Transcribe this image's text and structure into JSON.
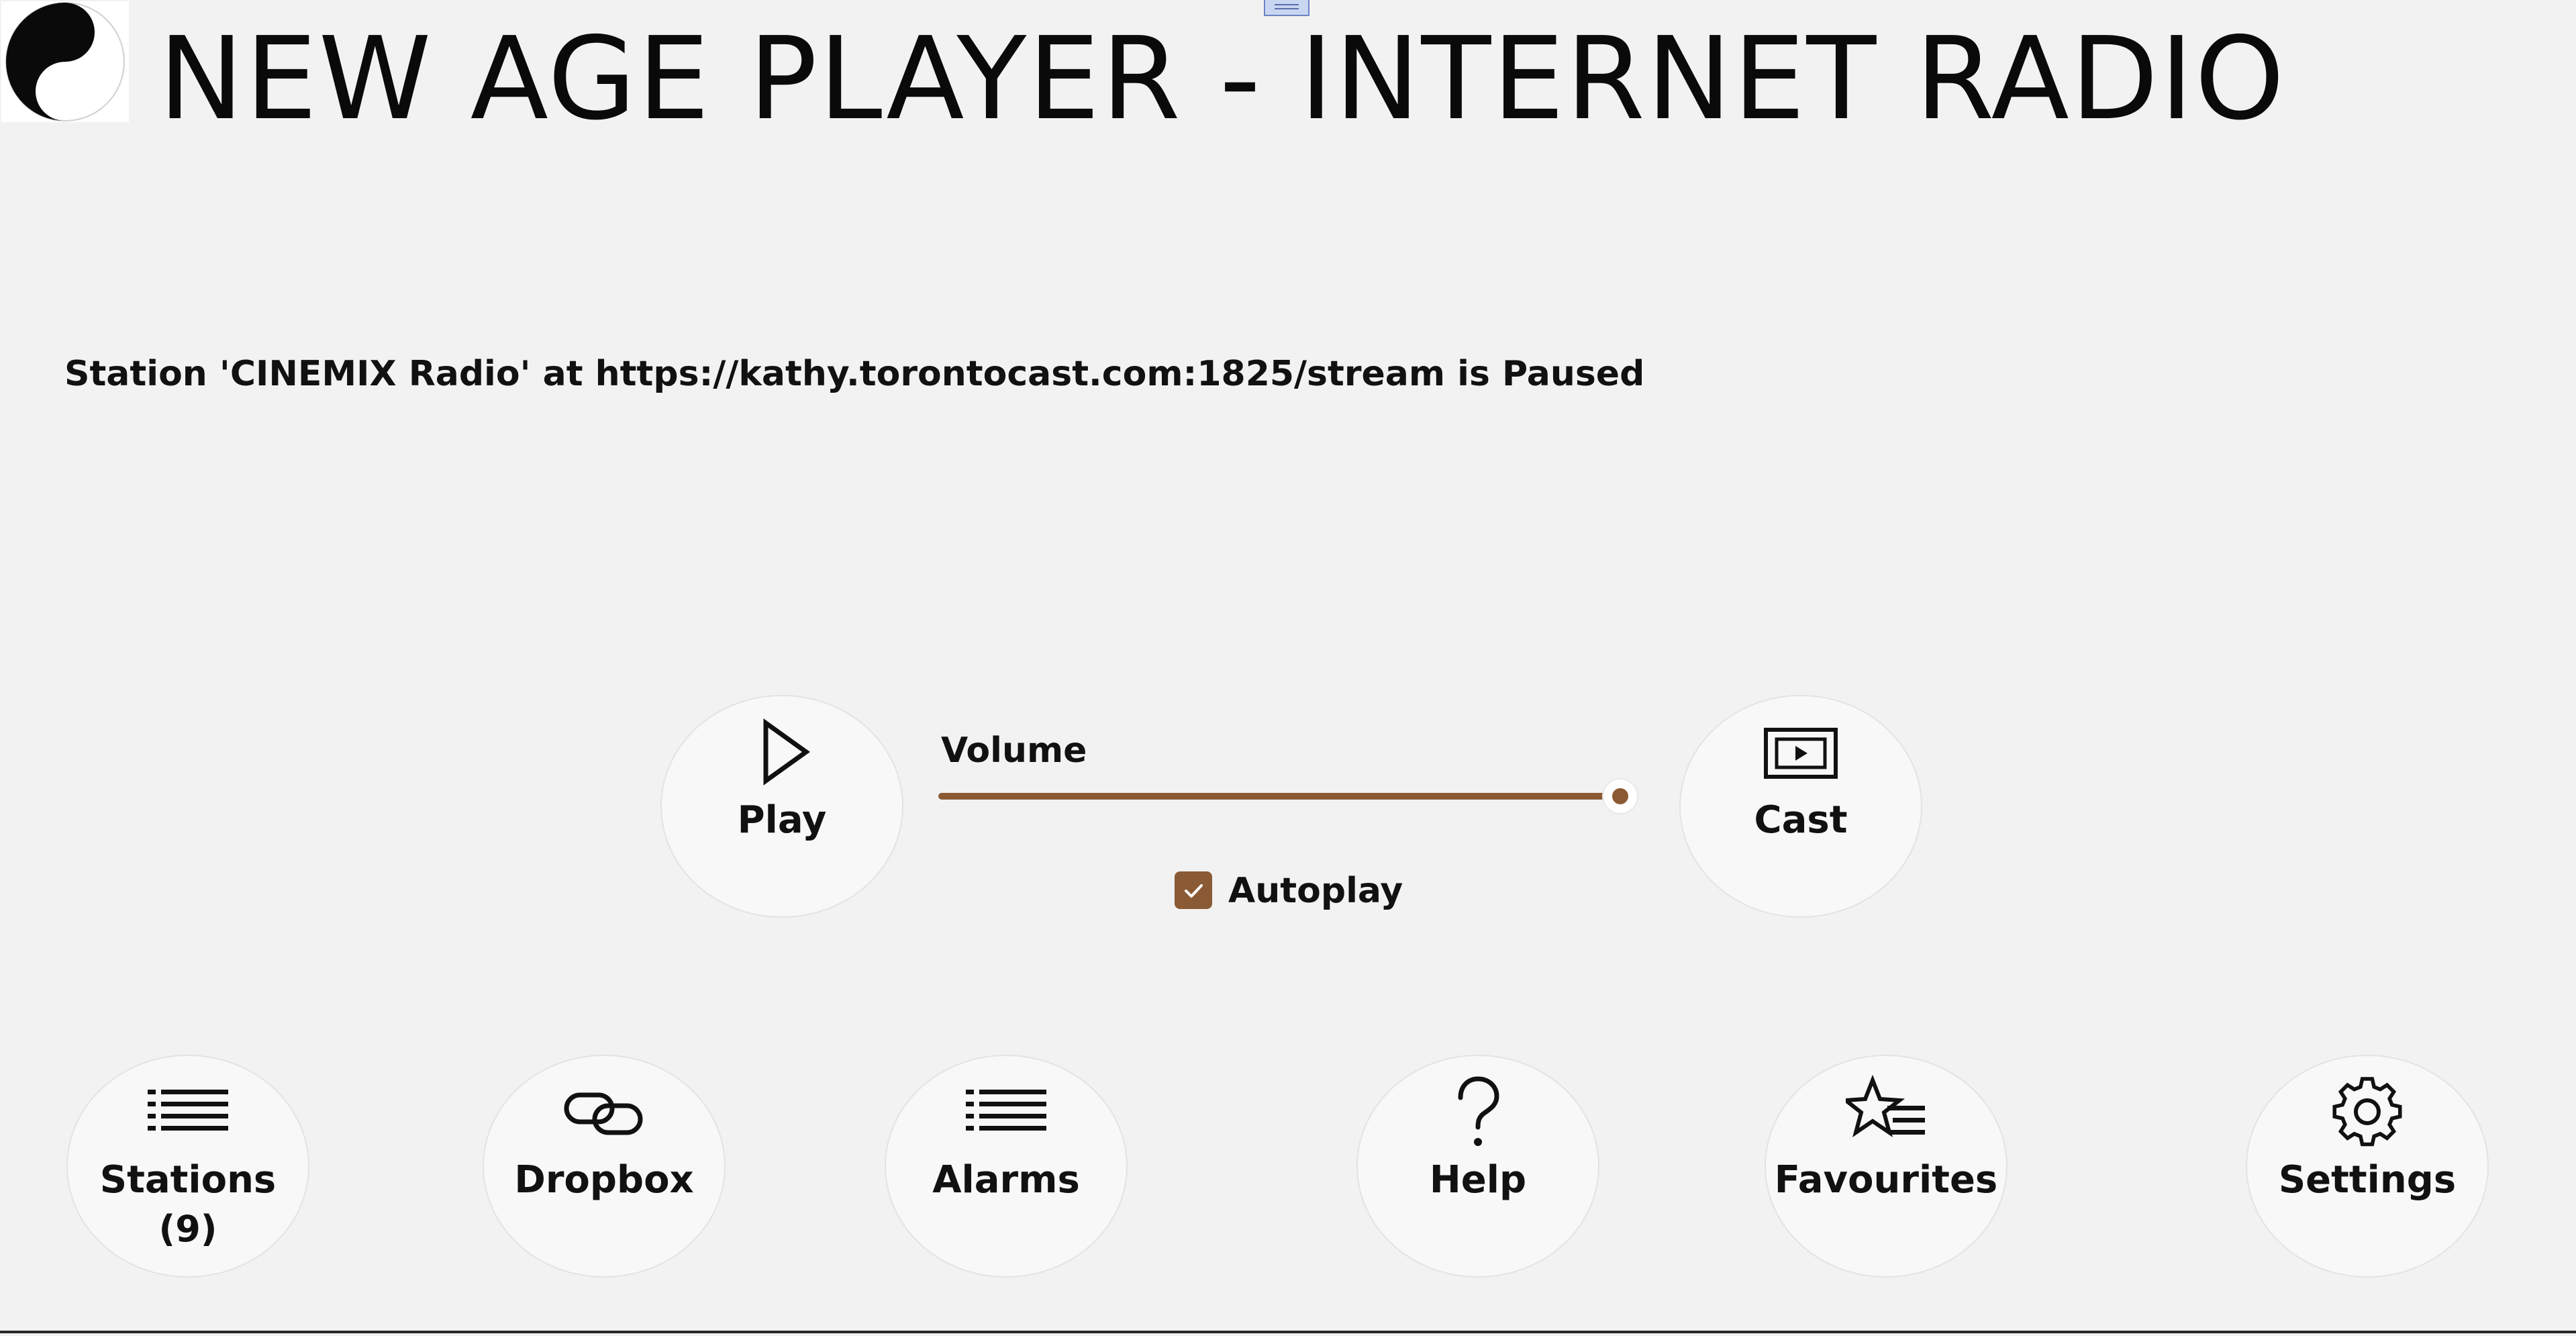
{
  "header": {
    "title": "NEW AGE PLAYER - INTERNET RADIO",
    "logo_icon": "yin-yang-icon"
  },
  "status": {
    "text": "Station 'CINEMIX Radio' at https://kathy.torontocast.com:1825/stream is Paused"
  },
  "controls": {
    "play": {
      "label": "Play",
      "icon": "play-icon"
    },
    "cast": {
      "label": "Cast",
      "icon": "cast-screen-icon"
    },
    "volume": {
      "label": "Volume",
      "level": 1.0
    },
    "autoplay": {
      "label": "Autoplay",
      "checked": true
    }
  },
  "nav": {
    "stations": {
      "label": "Stations",
      "count": "(9)",
      "icon": "list-icon"
    },
    "dropbox": {
      "label": "Dropbox",
      "icon": "link-icon"
    },
    "alarms": {
      "label": "Alarms",
      "icon": "list-icon"
    },
    "help": {
      "label": "Help",
      "icon": "question-mark-icon"
    },
    "favourites": {
      "label": "Favourites",
      "icon": "star-list-icon"
    },
    "settings": {
      "label": "Settings",
      "icon": "gear-icon"
    }
  },
  "colors": {
    "accent": "#8a5a34",
    "background": "#f2f2f2",
    "button_fill": "#f8f8f8"
  }
}
